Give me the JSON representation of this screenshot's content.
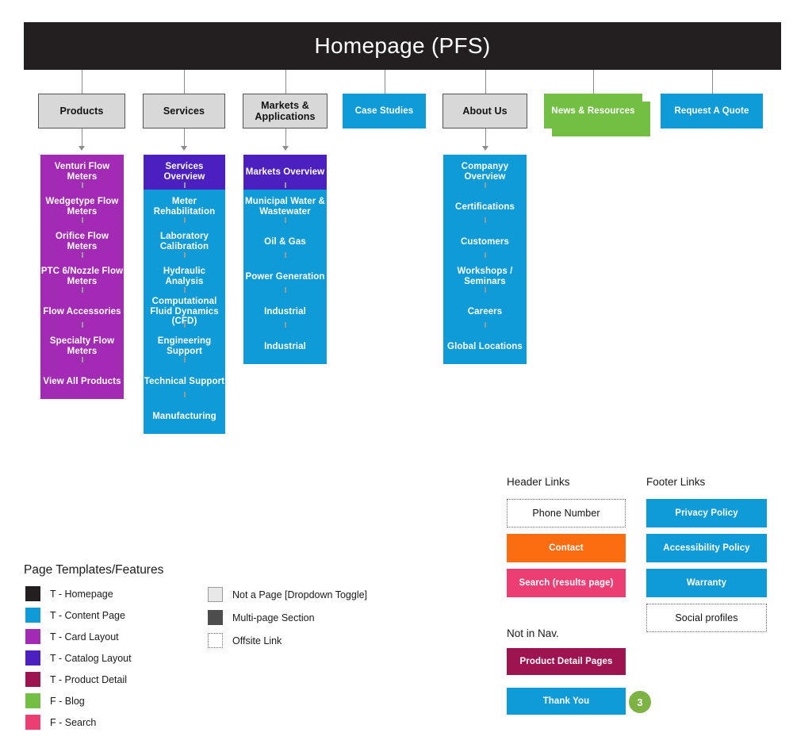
{
  "diagram": {
    "homepage": {
      "label": "Homepage (PFS)"
    },
    "top_nav": [
      {
        "label": "Products"
      },
      {
        "label": "Services"
      },
      {
        "label": "Markets &\nApplications"
      },
      {
        "label": "Case Studies"
      },
      {
        "label": "About Us"
      },
      {
        "label": "News & Resources"
      },
      {
        "label": "Request A Quote"
      }
    ],
    "columns": {
      "products": [
        {
          "label": "Venturi Flow\nMeters"
        },
        {
          "label": "Wedgetype Flow\nMeters"
        },
        {
          "label": "Orifice Flow Meters"
        },
        {
          "label": "PTC 6/Nozzle Flow\nMeters"
        },
        {
          "label": "Flow Accessories"
        },
        {
          "label": "Specialty Flow\nMeters"
        },
        {
          "label": "View All Products"
        }
      ],
      "services": [
        {
          "label": "Services Overview"
        },
        {
          "label": "Meter\nRehabilitation"
        },
        {
          "label": "Laboratory\nCalibration"
        },
        {
          "label": "Hydraulic Analysis"
        },
        {
          "label": "Computational\nFluid Dynamics\n(CFD)"
        },
        {
          "label": "Engineering\nSupport"
        },
        {
          "label": "Technical Support"
        },
        {
          "label": "Manufacturing"
        }
      ],
      "markets": [
        {
          "label": "Markets Overview"
        },
        {
          "label": "Municipal Water &\nWastewater"
        },
        {
          "label": "Oil & Gas"
        },
        {
          "label": "Power Generation"
        },
        {
          "label": "Industrial"
        },
        {
          "label": "Industrial"
        }
      ],
      "about": [
        {
          "label": "Companyy\nOverview"
        },
        {
          "label": "Certifications"
        },
        {
          "label": "Customers"
        },
        {
          "label": "Workshops /\nSeminars"
        },
        {
          "label": "Careers"
        },
        {
          "label": "Global Locations"
        }
      ]
    }
  },
  "header_links": {
    "title": "Header Links",
    "items": [
      {
        "label": "Phone Number"
      },
      {
        "label": "Contact"
      },
      {
        "label": "Search (results page)"
      }
    ]
  },
  "footer_links": {
    "title": "Footer Links",
    "items": [
      {
        "label": "Privacy Policy"
      },
      {
        "label": "Accessibility Policy"
      },
      {
        "label": "Warranty"
      },
      {
        "label": "Social profiles"
      }
    ]
  },
  "not_in_nav": {
    "title": "Not in Nav.",
    "items": [
      {
        "label": "Product Detail Pages"
      },
      {
        "label": "Thank You",
        "badge": "3"
      }
    ]
  },
  "legend": {
    "title": "Page Templates/Features",
    "left": [
      {
        "label": "T - Homepage",
        "color": "#231f20"
      },
      {
        "label": "T - Content Page",
        "color": "#0f9bd7"
      },
      {
        "label": "T - Card Layout",
        "color": "#a32ab4"
      },
      {
        "label": "T - Catalog Layout",
        "color": "#4b1fc0"
      },
      {
        "label": "T - Product Detail",
        "color": "#9e1450"
      },
      {
        "label": "F - Blog",
        "color": "#73bf44"
      },
      {
        "label": "F - Search",
        "color": "#ec3e72"
      }
    ],
    "right": [
      {
        "label": "Not a Page [Dropdown Toggle]",
        "kind": "gray"
      },
      {
        "label": "Multi-page Section",
        "kind": "multi"
      },
      {
        "label": "Offsite Link",
        "kind": "offsite"
      }
    ]
  }
}
